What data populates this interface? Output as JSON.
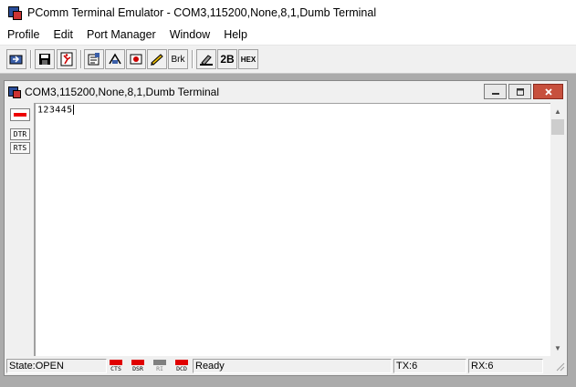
{
  "window": {
    "title": "PComm Terminal Emulator - COM3,115200,None,8,1,Dumb Terminal"
  },
  "menu": [
    "Profile",
    "Edit",
    "Port Manager",
    "Window",
    "Help"
  ],
  "toolbar": {
    "brk_label": "Brk",
    "twob_label": "2B",
    "hex_label": "HEX"
  },
  "child": {
    "title": "COM3,115200,None,8,1,Dumb Terminal",
    "signals": {
      "dtr": "DTR",
      "rts": "RTS"
    },
    "terminal_text": "123445"
  },
  "status": {
    "state": "State:OPEN",
    "indicators": [
      {
        "label": "CTS",
        "color": "#e00000"
      },
      {
        "label": "DSR",
        "color": "#e00000"
      },
      {
        "label": "RI",
        "color": "#808080"
      },
      {
        "label": "DCD",
        "color": "#e00000"
      }
    ],
    "message": "Ready",
    "tx": "TX:6",
    "rx": "RX:6"
  },
  "colors": {
    "led_on": "#e00000",
    "close_button": "#c7503d"
  }
}
